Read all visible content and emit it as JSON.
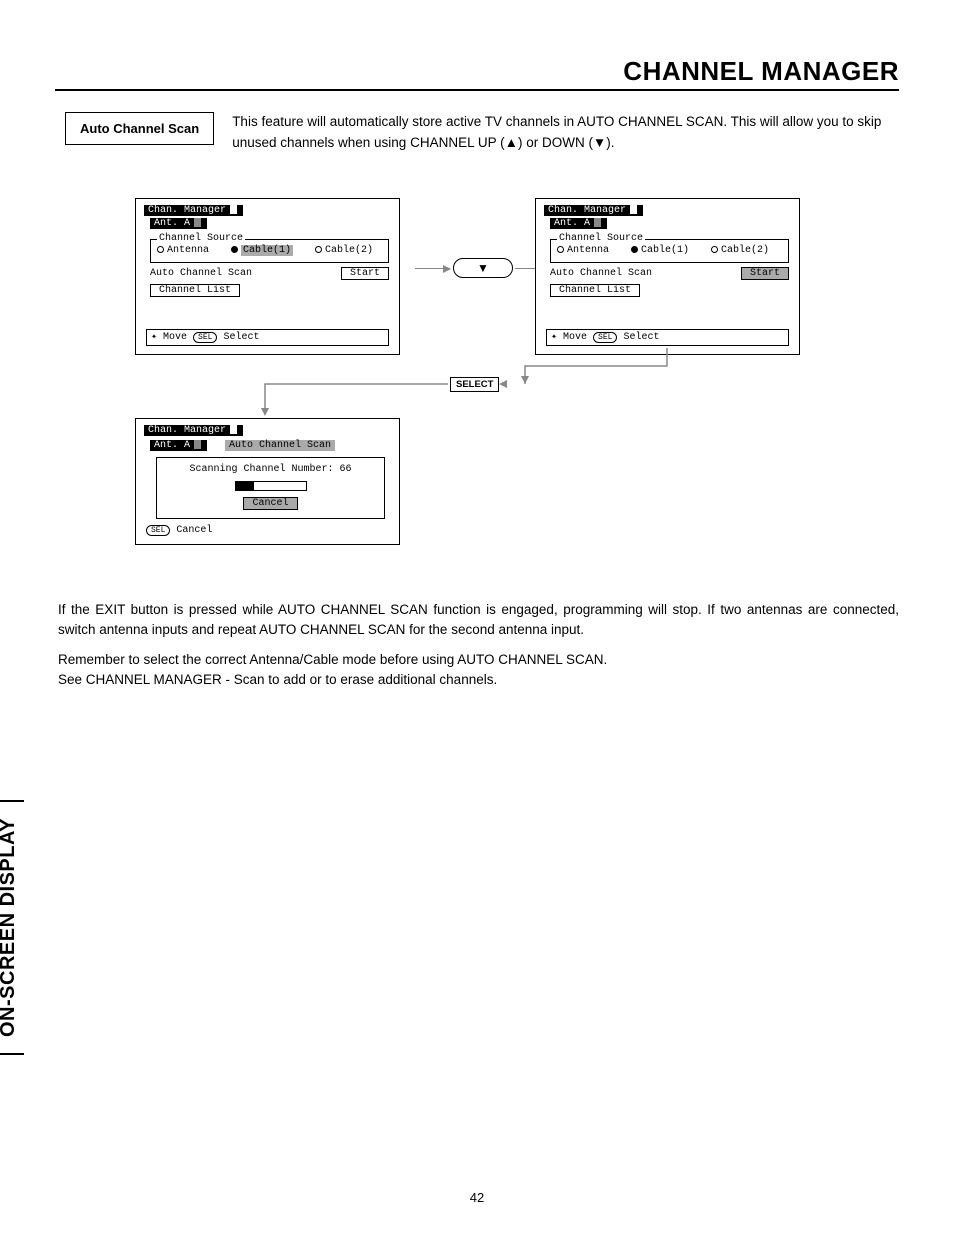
{
  "title": "CHANNEL MANAGER",
  "side_tab": "ON-SCREEN DISPLAY",
  "intro": {
    "label": "Auto Channel Scan",
    "text": "This feature will automatically store active TV channels in AUTO CHANNEL SCAN.  This will allow you to skip unused channels when using CHANNEL UP (▲) or DOWN (▼)."
  },
  "osd": {
    "title": "Chan. Manager",
    "ant": "Ant. A",
    "source_legend": "Channel Source",
    "antenna": "Antenna",
    "cable1": "Cable(1)",
    "cable2": "Cable(2)",
    "auto_scan": "Auto Channel Scan",
    "start": "Start",
    "chan_list": "Channel List",
    "move": "Move",
    "select": "Select",
    "cancel_foot": "Cancel",
    "scan_title": "Auto Channel Scan",
    "scan_line": "Scanning Channel Number: 66",
    "cancel_btn": "Cancel"
  },
  "nav": {
    "down": "▼",
    "select_label": "SELECT"
  },
  "para1": "If the EXIT button is pressed while AUTO CHANNEL SCAN function is engaged, programming will stop.  If two antennas are connected, switch antenna inputs and repeat AUTO CHANNEL SCAN for the second antenna input.",
  "para2": "Remember to select the correct Antenna/Cable mode before using AUTO CHANNEL SCAN.",
  "para3": "See CHANNEL MANAGER - Scan to add or to erase additional channels.",
  "page_number": "42"
}
